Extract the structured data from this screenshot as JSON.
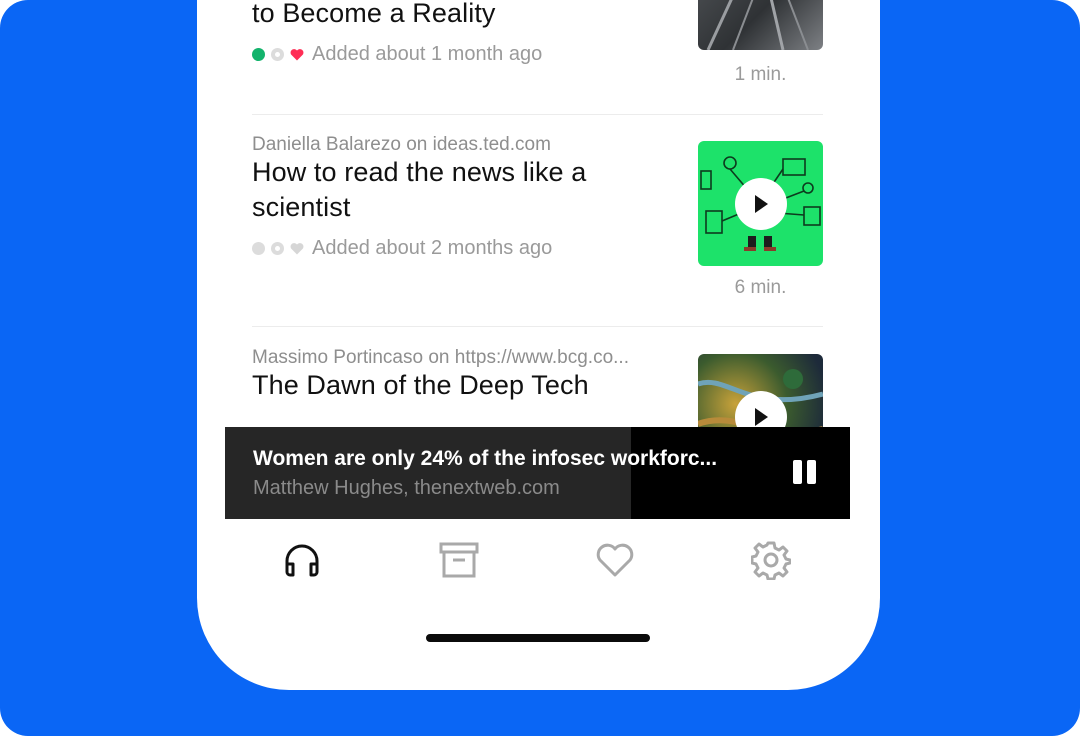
{
  "colors": {
    "background": "#0a66f5",
    "accent_green": "#13b36c",
    "heart_red": "#ff2d55",
    "text_primary": "#111111",
    "text_secondary": "#8e8e8e"
  },
  "articles": [
    {
      "source": "",
      "title": "to Become a Reality",
      "status_icons": [
        "green-dot",
        "grey-ring",
        "red-heart"
      ],
      "added": "Added about 1 month ago",
      "duration": "1 min."
    },
    {
      "source": "Daniella Balarezo on ideas.ted.com",
      "title": "How to read the news like a scientist",
      "status_icons": [
        "grey-dot",
        "grey-ring",
        "grey-heart"
      ],
      "added": "Added about 2 months ago",
      "duration": "6 min."
    },
    {
      "source": "Massimo Portincaso on https://www.bcg.co...",
      "title": "The Dawn of the Deep Tech",
      "status_icons": [],
      "added": "",
      "duration": ""
    }
  ],
  "now_playing": {
    "title": "Women are only 24% of the infosec workforc...",
    "subtitle": "Matthew Hughes, thenextweb.com",
    "progress_fraction": 0.65,
    "control_icon": "pause-icon"
  },
  "tabs": [
    {
      "icon": "headphones-icon",
      "active": true
    },
    {
      "icon": "archive-icon",
      "active": false
    },
    {
      "icon": "heart-icon",
      "active": false
    },
    {
      "icon": "gear-icon",
      "active": false
    }
  ]
}
